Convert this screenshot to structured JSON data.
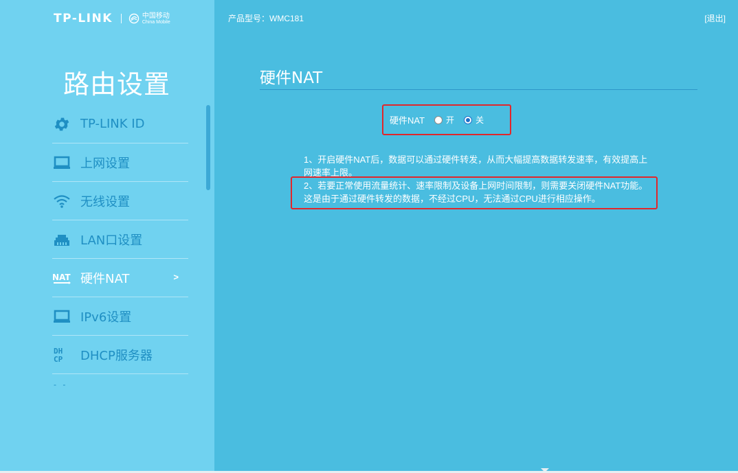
{
  "brand": {
    "name": "TP-LINK",
    "partner_cn": "中国移动",
    "partner_en": "China Mobile"
  },
  "header": {
    "model_label": "产品型号：WMC181",
    "logout_label": "[退出]"
  },
  "sidebar": {
    "title": "路由设置",
    "items": [
      {
        "label": "TP-LINK ID",
        "icon": "gear-icon"
      },
      {
        "label": "上网设置",
        "icon": "laptop-icon"
      },
      {
        "label": "无线设置",
        "icon": "wifi-icon"
      },
      {
        "label": "LAN口设置",
        "icon": "lan-port-icon"
      },
      {
        "label": "硬件NAT",
        "icon": "nat-icon",
        "active": true,
        "arrow": ">"
      },
      {
        "label": "IPv6设置",
        "icon": "laptop-icon"
      },
      {
        "label": "DHCP服务器",
        "icon": "dhcp-icon"
      }
    ],
    "more": "- -"
  },
  "main": {
    "title": "硬件NAT",
    "nat_setting": {
      "label": "硬件NAT",
      "options": [
        {
          "label": "开",
          "checked": false
        },
        {
          "label": "关",
          "checked": true
        }
      ]
    },
    "notes": [
      "1、开启硬件NAT后，数据可以通过硬件转发，从而大幅提高数据转发速率，有效提高上网速率上限。",
      "2、若要正常使用流量统计、速率限制及设备上网时间限制，则需要关闭硬件NAT功能。这是由于通过硬件转发的数据，不经过CPU，无法通过CPU进行相应操作。"
    ]
  },
  "colors": {
    "sidebar_bg": "#70d2f0",
    "main_bg": "#4abde0",
    "highlight_red": "#e2262a",
    "menu_text": "#1f8fc3"
  }
}
